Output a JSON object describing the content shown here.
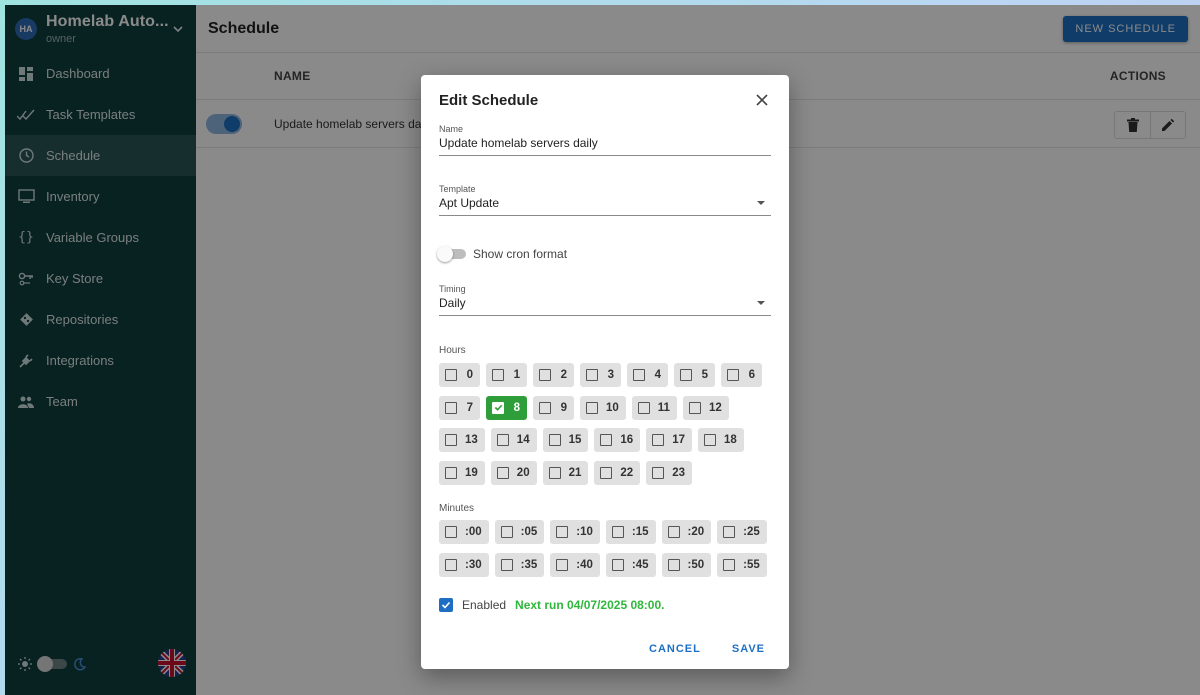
{
  "sidebar": {
    "project": {
      "initials": "HA",
      "name": "Homelab Auto...",
      "role": "owner"
    },
    "items": [
      {
        "label": "Dashboard",
        "icon": "dashboard-icon",
        "active": false
      },
      {
        "label": "Task Templates",
        "icon": "checks-icon",
        "active": false
      },
      {
        "label": "Schedule",
        "icon": "clock-icon",
        "active": true
      },
      {
        "label": "Inventory",
        "icon": "monitor-icon",
        "active": false
      },
      {
        "label": "Variable Groups",
        "icon": "braces-icon",
        "active": false
      },
      {
        "label": "Key Store",
        "icon": "key-icon",
        "active": false
      },
      {
        "label": "Repositories",
        "icon": "git-icon",
        "active": false
      },
      {
        "label": "Integrations",
        "icon": "plug-icon",
        "active": false
      },
      {
        "label": "Team",
        "icon": "people-icon",
        "active": false
      }
    ]
  },
  "header": {
    "title": "Schedule",
    "new_button": "NEW SCHEDULE"
  },
  "table": {
    "columns": {
      "name": "NAME",
      "actions": "ACTIONS"
    },
    "rows": [
      {
        "name": "Update homelab servers daily",
        "enabled": true
      }
    ]
  },
  "dialog": {
    "title": "Edit Schedule",
    "name": {
      "label": "Name",
      "value": "Update homelab servers daily"
    },
    "template": {
      "label": "Template",
      "value": "Apt Update"
    },
    "cron_toggle": {
      "label": "Show cron format",
      "on": false
    },
    "timing": {
      "label": "Timing",
      "value": "Daily"
    },
    "hours": {
      "label": "Hours",
      "rows": [
        [
          "0",
          "1",
          "2",
          "3",
          "4",
          "5",
          "6"
        ],
        [
          "7",
          "8",
          "9",
          "10",
          "11",
          "12"
        ],
        [
          "13",
          "14",
          "15",
          "16",
          "17",
          "18"
        ],
        [
          "19",
          "20",
          "21",
          "22",
          "23"
        ]
      ],
      "selected": [
        "8"
      ]
    },
    "minutes": {
      "label": "Minutes",
      "rows": [
        [
          ":00",
          ":05",
          ":10",
          ":15",
          ":20",
          ":25"
        ],
        [
          ":30",
          ":35",
          ":40",
          ":45",
          ":50",
          ":55"
        ]
      ],
      "selected": []
    },
    "enabled": {
      "label": "Enabled",
      "checked": true,
      "next_run": "Next run 04/07/2025 08:00."
    },
    "cancel": "CANCEL",
    "save": "SAVE"
  },
  "colors": {
    "sidebar": "#0f3d3e",
    "accent": "#1e6fc4",
    "selected_chip": "#2e9e3a",
    "next_run": "#2eb83c"
  }
}
